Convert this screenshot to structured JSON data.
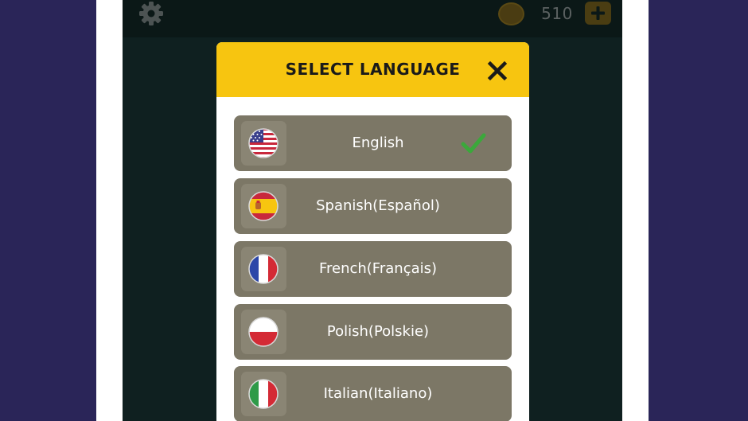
{
  "topbar": {
    "settings_icon": "gear-icon",
    "coin_icon": "coin-icon",
    "coin_count": "510",
    "add_coins_icon": "plus-icon"
  },
  "dialog": {
    "title": "SELECT LANGUAGE",
    "close_icon": "close-icon",
    "languages": [
      {
        "label": "English",
        "flag": "us-flag-icon",
        "selected": true
      },
      {
        "label": "Spanish(Español)",
        "flag": "spain-flag-icon",
        "selected": false
      },
      {
        "label": "French(Français)",
        "flag": "france-flag-icon",
        "selected": false
      },
      {
        "label": "Polish(Polskie)",
        "flag": "poland-flag-icon",
        "selected": false
      },
      {
        "label": "Italian(Italiano)",
        "flag": "italy-flag-icon",
        "selected": false
      }
    ]
  },
  "colors": {
    "header_yellow": "#f7c510",
    "item_bg": "#7c7766",
    "check_green": "#3ba83b",
    "background": "#2a2558"
  }
}
